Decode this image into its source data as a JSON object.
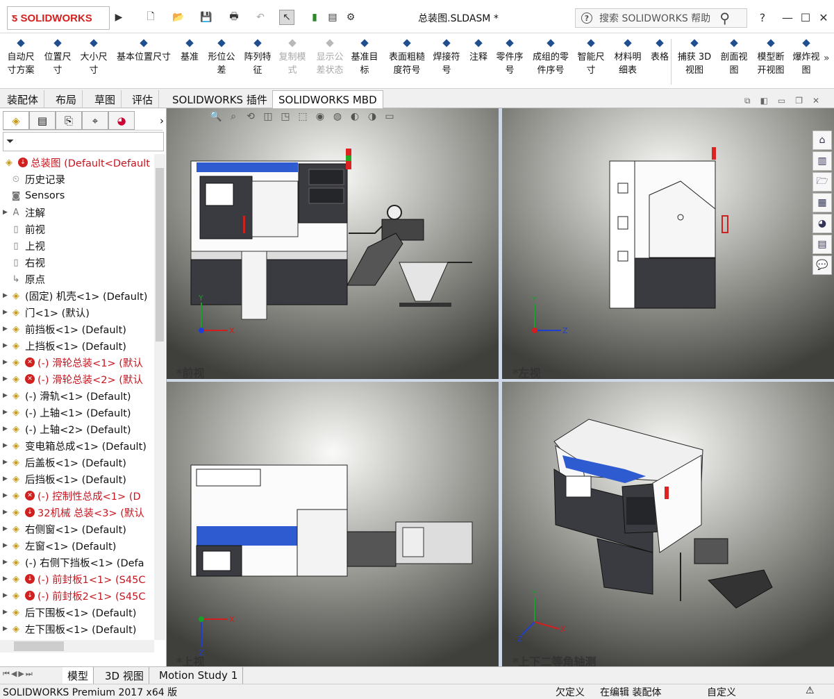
{
  "app": {
    "logo": "SOLIDWORKS",
    "document_title": "总装图.SLDASM *",
    "search_placeholder": "搜索 SOLIDWORKS 帮助",
    "help": "?"
  },
  "ribbon": [
    {
      "label1": "自动尺",
      "label2": "寸方案",
      "icon": "auto-dimension-icon",
      "enabled": true
    },
    {
      "label1": "位置尺",
      "label2": "寸",
      "icon": "location-dimension-icon",
      "enabled": true
    },
    {
      "label1": "大小尺",
      "label2": "寸",
      "icon": "size-dimension-icon",
      "enabled": true
    },
    {
      "label1": "基本位置尺寸",
      "label2": "",
      "icon": "basic-location-dimension-icon",
      "enabled": true
    },
    {
      "label1": "基准",
      "label2": "",
      "icon": "datum-icon",
      "enabled": true
    },
    {
      "label1": "形位公",
      "label2": "差",
      "icon": "geometric-tolerance-icon",
      "enabled": true
    },
    {
      "label1": "阵列特",
      "label2": "征",
      "icon": "pattern-feature-icon",
      "enabled": true
    },
    {
      "label1": "复制模",
      "label2": "式",
      "icon": "copy-scheme-icon",
      "enabled": false
    },
    {
      "label1": "显示公",
      "label2": "差状态",
      "icon": "tolerance-status-icon",
      "enabled": false
    },
    {
      "label1": "基准目",
      "label2": "标",
      "icon": "datum-target-icon",
      "enabled": true
    },
    {
      "label1": "表面粗糙",
      "label2": "度符号",
      "icon": "surface-finish-icon",
      "enabled": true
    },
    {
      "label1": "焊接符",
      "label2": "号",
      "icon": "weld-symbol-icon",
      "enabled": true
    },
    {
      "label1": "注释",
      "label2": "",
      "icon": "note-icon",
      "enabled": true
    },
    {
      "label1": "零件序",
      "label2": "号",
      "icon": "balloon-icon",
      "enabled": true
    },
    {
      "label1": "成组的零",
      "label2": "件序号",
      "icon": "stacked-balloon-icon",
      "enabled": true
    },
    {
      "label1": "智能尺",
      "label2": "寸",
      "icon": "smart-dimension-icon",
      "enabled": true
    },
    {
      "label1": "材料明",
      "label2": "细表",
      "icon": "bom-icon",
      "enabled": true
    },
    {
      "label1": "表格",
      "label2": "",
      "icon": "table-icon",
      "enabled": true
    },
    {
      "label1": "捕获 3D",
      "label2": "视图",
      "icon": "capture-3d-view-icon",
      "enabled": true
    },
    {
      "label1": "剖面视",
      "label2": "图",
      "icon": "section-view-icon",
      "enabled": true
    },
    {
      "label1": "模型断",
      "label2": "开视图",
      "icon": "model-break-view-icon",
      "enabled": true
    },
    {
      "label1": "爆炸视",
      "label2": "图",
      "icon": "exploded-view-icon",
      "enabled": true
    }
  ],
  "command_tabs": [
    "装配体",
    "布局",
    "草图",
    "评估",
    "SOLIDWORKS 插件",
    "SOLIDWORKS MBD"
  ],
  "tree": [
    {
      "label": "总装图  (Default<Default",
      "icon": "asm",
      "badge": "down",
      "red": true,
      "arrow": false
    },
    {
      "label": "历史记录",
      "icon": "history",
      "badge": "",
      "red": false,
      "arrow": false
    },
    {
      "label": "Sensors",
      "icon": "sensor",
      "badge": "",
      "red": false,
      "arrow": false
    },
    {
      "label": "注解",
      "icon": "annot",
      "badge": "",
      "red": false,
      "arrow": true
    },
    {
      "label": "前视",
      "icon": "plane",
      "badge": "",
      "red": false,
      "arrow": false
    },
    {
      "label": "上视",
      "icon": "plane",
      "badge": "",
      "red": false,
      "arrow": false
    },
    {
      "label": "右视",
      "icon": "plane",
      "badge": "",
      "red": false,
      "arrow": false
    },
    {
      "label": "原点",
      "icon": "origin",
      "badge": "",
      "red": false,
      "arrow": false
    },
    {
      "label": "(固定) 机壳<1> (Default)",
      "icon": "asm",
      "badge": "",
      "red": false,
      "arrow": true
    },
    {
      "label": "门<1> (默认)",
      "icon": "asm",
      "badge": "",
      "red": false,
      "arrow": true
    },
    {
      "label": "前挡板<1> (Default)",
      "icon": "asm",
      "badge": "",
      "red": false,
      "arrow": true
    },
    {
      "label": "上挡板<1> (Default)",
      "icon": "asm",
      "badge": "",
      "red": false,
      "arrow": true
    },
    {
      "label": "(-) 滑轮总装<1> (默认",
      "icon": "asm",
      "badge": "x",
      "red": true,
      "arrow": true
    },
    {
      "label": "(-) 滑轮总装<2> (默认",
      "icon": "asm",
      "badge": "x",
      "red": true,
      "arrow": true
    },
    {
      "label": "(-) 滑轨<1> (Default)",
      "icon": "asm",
      "badge": "",
      "red": false,
      "arrow": true
    },
    {
      "label": "(-) 上轴<1> (Default)",
      "icon": "asm",
      "badge": "",
      "red": false,
      "arrow": true
    },
    {
      "label": "(-) 上轴<2> (Default)",
      "icon": "asm",
      "badge": "",
      "red": false,
      "arrow": true
    },
    {
      "label": "变电箱总成<1> (Default)",
      "icon": "asm",
      "badge": "",
      "red": false,
      "arrow": true
    },
    {
      "label": "后盖板<1> (Default)",
      "icon": "asm",
      "badge": "",
      "red": false,
      "arrow": true
    },
    {
      "label": "后挡板<1> (Default)",
      "icon": "asm",
      "badge": "",
      "red": false,
      "arrow": true
    },
    {
      "label": "(-) 控制性总成<1> (D",
      "icon": "asm",
      "badge": "x",
      "red": true,
      "arrow": true
    },
    {
      "label": "32机械 总装<3> (默认",
      "icon": "asm",
      "badge": "down",
      "red": true,
      "arrow": true
    },
    {
      "label": "右侧窗<1> (Default)",
      "icon": "asm",
      "badge": "",
      "red": false,
      "arrow": true
    },
    {
      "label": "左窗<1> (Default)",
      "icon": "asm",
      "badge": "",
      "red": false,
      "arrow": true
    },
    {
      "label": "(-) 右侧下挡板<1> (Defa",
      "icon": "asm",
      "badge": "",
      "red": false,
      "arrow": true
    },
    {
      "label": "(-) 前封板1<1> (S45C",
      "icon": "asm",
      "badge": "down",
      "red": true,
      "arrow": true
    },
    {
      "label": "(-) 前封板2<1> (S45C",
      "icon": "asm",
      "badge": "down",
      "red": true,
      "arrow": true
    },
    {
      "label": "后下围板<1> (Default)",
      "icon": "asm",
      "badge": "",
      "red": false,
      "arrow": true
    },
    {
      "label": "左下围板<1> (Default)",
      "icon": "asm",
      "badge": "",
      "red": false,
      "arrow": true
    }
  ],
  "viewports": {
    "front": "*前视",
    "left": "*左视",
    "top": "*上视",
    "iso": "*上下二等角轴测"
  },
  "axes": {
    "x": "X",
    "y": "Y",
    "z": "Z"
  },
  "bottom_tabs": [
    "模型",
    "3D 视图",
    "Motion Study 1"
  ],
  "status": {
    "product": "SOLIDWORKS Premium 2017 x64 版",
    "define": "欠定义",
    "editing": "在编辑 装配体",
    "custom": "自定义"
  }
}
